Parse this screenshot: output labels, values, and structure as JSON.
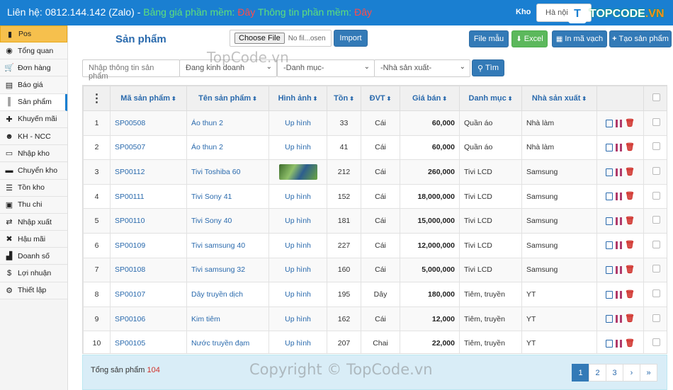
{
  "topbar": {
    "contact_label": "Liên hệ: 0812.144.142 (Zalo) - ",
    "price_text": "Bảng giá phần mềm: ",
    "price_link": "Đây",
    "info_text": " Thông tin phần mềm: ",
    "info_link": "Đây",
    "kho_label": "Kho",
    "kho_value": "Hà nội",
    "logo_mark": "T",
    "logo_text": "TOPCODE",
    "logo_suffix": ".VN",
    "colors": {
      "bar": "#1a7fd1",
      "green": "#5fe07a",
      "red": "#ff4b4b"
    }
  },
  "sidebar": {
    "items": [
      {
        "label": "Pos",
        "icon": "signal-icon"
      },
      {
        "label": "Tổng quan",
        "icon": "dashboard-icon"
      },
      {
        "label": "Đơn hàng",
        "icon": "cart-icon"
      },
      {
        "label": "Báo giá",
        "icon": "document-icon"
      },
      {
        "label": "Sản phẩm",
        "icon": "barcode-icon"
      },
      {
        "label": "Khuyến mãi",
        "icon": "gift-icon"
      },
      {
        "label": "KH - NCC",
        "icon": "users-icon"
      },
      {
        "label": "Nhập kho",
        "icon": "inbox-icon"
      },
      {
        "label": "Chuyển kho",
        "icon": "truck-icon"
      },
      {
        "label": "Tồn kho",
        "icon": "list-icon"
      },
      {
        "label": "Thu chi",
        "icon": "money-icon"
      },
      {
        "label": "Nhập xuất",
        "icon": "transfer-icon"
      },
      {
        "label": "Hậu mãi",
        "icon": "tools-icon"
      },
      {
        "label": "Doanh số",
        "icon": "chart-icon"
      },
      {
        "label": "Lợi nhuận",
        "icon": "dollar-icon"
      },
      {
        "label": "Thiết lập",
        "icon": "settings-icon"
      }
    ]
  },
  "header": {
    "title": "Sản phẩm",
    "choose_file": "Choose File",
    "file_name": "No fil...osen",
    "import": "Import",
    "file_mau": "File mẫu",
    "excel": "Excel",
    "in_ma_vach": "In mã vạch",
    "tao_san_pham": "Tạo sản phẩm"
  },
  "filters": {
    "search_placeholder": "Nhập thông tin sản phẩm",
    "status": "Đang kinh doanh",
    "category": "-Danh mục-",
    "maker": "-Nhà sản xuất-",
    "search_button": "Tìm"
  },
  "table": {
    "menu_icon": "⋮",
    "headers": [
      "Mã sản phẩm",
      "Tên sản phẩm",
      "Hình ảnh",
      "Tồn",
      "ĐVT",
      "Giá bán",
      "Danh mục",
      "Nhà sản xuất"
    ],
    "upload_label": "Up hình",
    "rows": [
      {
        "no": "1",
        "code": "SP00508",
        "name": "Áo thun 2",
        "image": "upload",
        "stock": "33",
        "unit": "Cái",
        "price": "60,000",
        "category": "Quần áo",
        "maker": "Nhà làm"
      },
      {
        "no": "2",
        "code": "SP00507",
        "name": "Áo thun 2",
        "image": "upload",
        "stock": "41",
        "unit": "Cái",
        "price": "60,000",
        "category": "Quần áo",
        "maker": "Nhà làm"
      },
      {
        "no": "3",
        "code": "SP00112",
        "name": "Tivi Toshiba 60",
        "image": "thumb",
        "stock": "212",
        "unit": "Cái",
        "price": "260,000",
        "category": "Tivi LCD",
        "maker": "Samsung"
      },
      {
        "no": "4",
        "code": "SP00111",
        "name": "Tivi Sony 41",
        "image": "upload",
        "stock": "152",
        "unit": "Cái",
        "price": "18,000,000",
        "category": "Tivi LCD",
        "maker": "Samsung"
      },
      {
        "no": "5",
        "code": "SP00110",
        "name": "Tivi Sony 40",
        "image": "upload",
        "stock": "181",
        "unit": "Cái",
        "price": "15,000,000",
        "category": "Tivi LCD",
        "maker": "Samsung"
      },
      {
        "no": "6",
        "code": "SP00109",
        "name": "Tivi samsung 40",
        "image": "upload",
        "stock": "227",
        "unit": "Cái",
        "price": "12,000,000",
        "category": "Tivi LCD",
        "maker": "Samsung"
      },
      {
        "no": "7",
        "code": "SP00108",
        "name": "Tivi samsung 32",
        "image": "upload",
        "stock": "160",
        "unit": "Cái",
        "price": "5,000,000",
        "category": "Tivi LCD",
        "maker": "Samsung"
      },
      {
        "no": "8",
        "code": "SP00107",
        "name": "Dây truyền dịch",
        "image": "upload",
        "stock": "195",
        "unit": "Dây",
        "price": "180,000",
        "category": "Tiêm, truyền",
        "maker": "YT"
      },
      {
        "no": "9",
        "code": "SP00106",
        "name": "Kim tiêm",
        "image": "upload",
        "stock": "162",
        "unit": "Cái",
        "price": "12,000",
        "category": "Tiêm, truyền",
        "maker": "YT"
      },
      {
        "no": "10",
        "code": "SP00105",
        "name": "Nước truyền đạm",
        "image": "upload",
        "stock": "207",
        "unit": "Chai",
        "price": "22,000",
        "category": "Tiêm, truyền",
        "maker": "YT"
      }
    ]
  },
  "footer": {
    "total_label": "Tổng sản phẩm",
    "total_count": "104",
    "pages": [
      "1",
      "2",
      "3",
      "›",
      "»"
    ],
    "current_page": "1"
  },
  "watermarks": {
    "top": "TopCode.vn",
    "bottom": "Copyright © TopCode.vn"
  }
}
